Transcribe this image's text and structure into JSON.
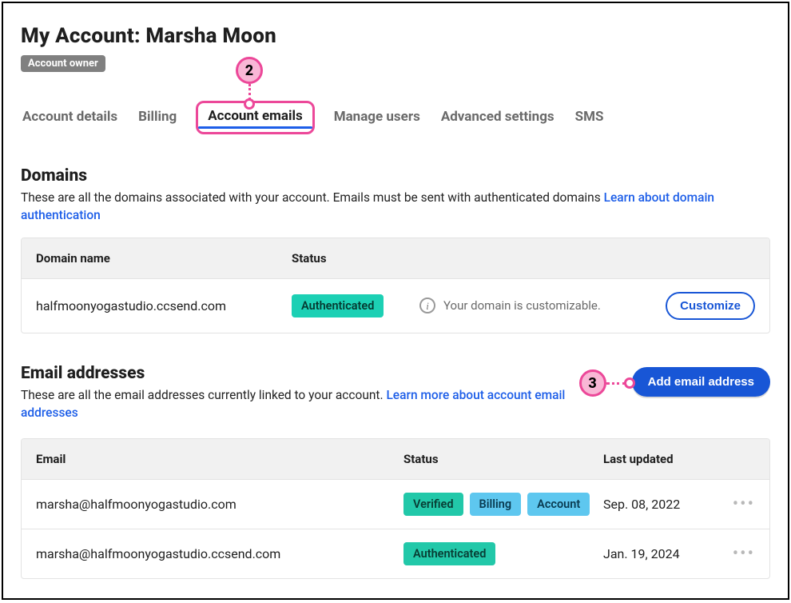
{
  "header": {
    "title": "My Account: Marsha Moon",
    "owner_badge": "Account owner"
  },
  "tabs": [
    {
      "label": "Account details",
      "active": false
    },
    {
      "label": "Billing",
      "active": false
    },
    {
      "label": "Account emails",
      "active": true
    },
    {
      "label": "Manage users",
      "active": false
    },
    {
      "label": "Advanced settings",
      "active": false
    },
    {
      "label": "SMS",
      "active": false
    }
  ],
  "domains": {
    "heading": "Domains",
    "description": "These are all the domains associated with your account. Emails must be sent with authenticated domains ",
    "learn_link": "Learn about domain authentication",
    "columns": {
      "name": "Domain name",
      "status": "Status"
    },
    "rows": [
      {
        "name": "halfmoonyogastudio.ccsend.com",
        "status": "Authenticated",
        "note": "Your domain is customizable.",
        "action": "Customize"
      }
    ]
  },
  "emails": {
    "heading": "Email addresses",
    "description": "These are all the email addresses currently linked to your account. ",
    "learn_link": "Learn more about account email addresses",
    "add_button": "Add email address",
    "columns": {
      "email": "Email",
      "status": "Status",
      "updated": "Last updated"
    },
    "rows": [
      {
        "email": "marsha@halfmoonyogastudio.com",
        "badges": [
          "Verified",
          "Billing",
          "Account"
        ],
        "updated": "Sep. 08, 2022"
      },
      {
        "email": "marsha@halfmoonyogastudio.ccsend.com",
        "badges": [
          "Authenticated"
        ],
        "updated": "Jan. 19, 2024"
      }
    ]
  },
  "callouts": {
    "2": "2",
    "3": "3"
  }
}
